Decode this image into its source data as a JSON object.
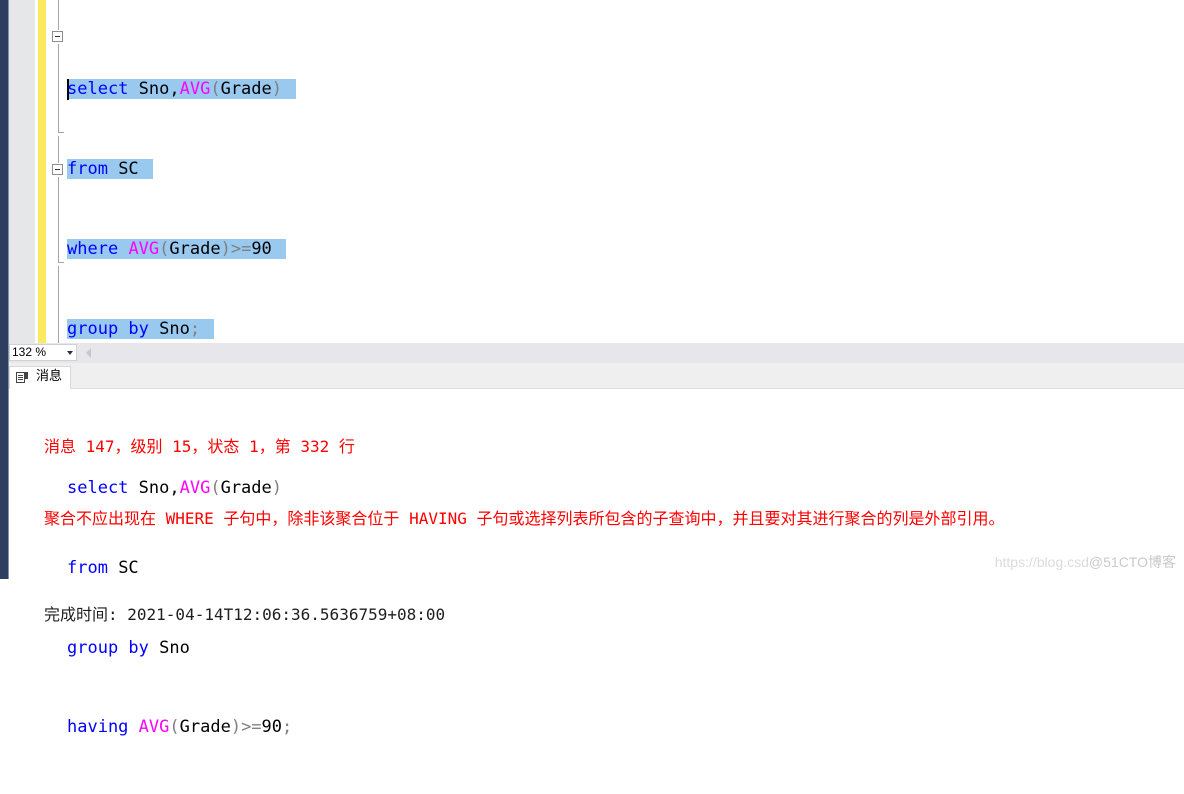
{
  "editor": {
    "query1": {
      "line1": {
        "kw1": "select",
        "text1": " Sno,",
        "fn": "AVG",
        "paren_open": "(",
        "arg": "Grade",
        "paren_close": ")"
      },
      "line2": {
        "kw": "from",
        "text": " SC"
      },
      "line3": {
        "kw": "where",
        "sp": " ",
        "fn": "AVG",
        "paren_open": "(",
        "arg": "Grade",
        "op": ")>=",
        "num": "90"
      },
      "line4": {
        "kw": "group by",
        "text": " Sno",
        "semi": ";"
      }
    },
    "query2": {
      "line1": {
        "kw1": "select",
        "text1": " Sno,",
        "fn": "AVG",
        "paren_open": "(",
        "arg": "Grade",
        "paren_close": ")"
      },
      "line2": {
        "kw": "from",
        "text": " SC"
      },
      "line3": {
        "kw": "group by",
        "text": " Sno"
      },
      "line4": {
        "kw": "having",
        "sp": " ",
        "fn": "AVG",
        "paren_open": "(",
        "arg": "Grade",
        "op": ")>=",
        "num": "90",
        "semi": ";"
      }
    },
    "colors": {
      "keyword": "#0000ff",
      "function": "#ff00ff",
      "operator": "#808080",
      "selection": "#99c9ef"
    }
  },
  "zoom": {
    "value": "132 %"
  },
  "results": {
    "tab_label": "消息",
    "error_header": "消息 147，级别 15，状态 1，第 332 行",
    "error_text": "聚合不应出现在 WHERE 子句中，除非该聚合位于 HAVING 子句或选择列表所包含的子查询中，并且要对其进行聚合的列是外部引用。",
    "completion": "完成时间: 2021-04-14T12:06:36.5636759+08:00",
    "error_color": "#ff0000"
  },
  "watermark": {
    "part1": "https://blog.csd",
    "part2": "@51CTO博客"
  }
}
